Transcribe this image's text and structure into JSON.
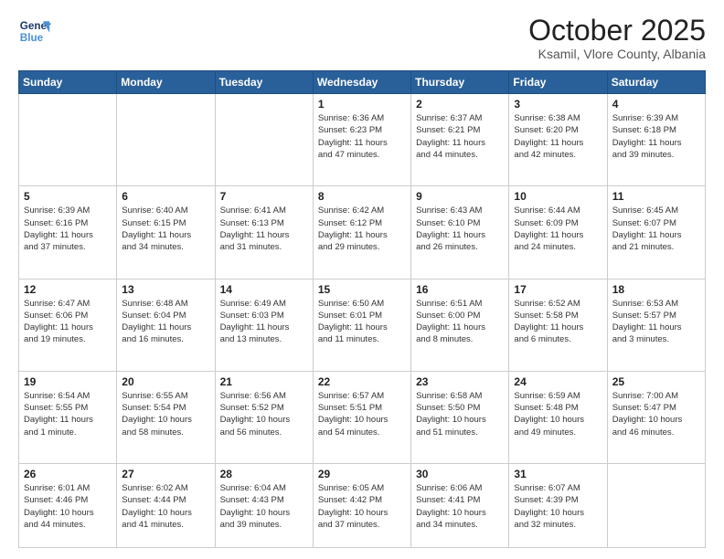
{
  "header": {
    "logo_line1": "General",
    "logo_line2": "Blue",
    "month": "October 2025",
    "location": "Ksamil, Vlore County, Albania"
  },
  "days_of_week": [
    "Sunday",
    "Monday",
    "Tuesday",
    "Wednesday",
    "Thursday",
    "Friday",
    "Saturday"
  ],
  "weeks": [
    [
      {
        "day": "",
        "info": ""
      },
      {
        "day": "",
        "info": ""
      },
      {
        "day": "",
        "info": ""
      },
      {
        "day": "1",
        "info": "Sunrise: 6:36 AM\nSunset: 6:23 PM\nDaylight: 11 hours\nand 47 minutes."
      },
      {
        "day": "2",
        "info": "Sunrise: 6:37 AM\nSunset: 6:21 PM\nDaylight: 11 hours\nand 44 minutes."
      },
      {
        "day": "3",
        "info": "Sunrise: 6:38 AM\nSunset: 6:20 PM\nDaylight: 11 hours\nand 42 minutes."
      },
      {
        "day": "4",
        "info": "Sunrise: 6:39 AM\nSunset: 6:18 PM\nDaylight: 11 hours\nand 39 minutes."
      }
    ],
    [
      {
        "day": "5",
        "info": "Sunrise: 6:39 AM\nSunset: 6:16 PM\nDaylight: 11 hours\nand 37 minutes."
      },
      {
        "day": "6",
        "info": "Sunrise: 6:40 AM\nSunset: 6:15 PM\nDaylight: 11 hours\nand 34 minutes."
      },
      {
        "day": "7",
        "info": "Sunrise: 6:41 AM\nSunset: 6:13 PM\nDaylight: 11 hours\nand 31 minutes."
      },
      {
        "day": "8",
        "info": "Sunrise: 6:42 AM\nSunset: 6:12 PM\nDaylight: 11 hours\nand 29 minutes."
      },
      {
        "day": "9",
        "info": "Sunrise: 6:43 AM\nSunset: 6:10 PM\nDaylight: 11 hours\nand 26 minutes."
      },
      {
        "day": "10",
        "info": "Sunrise: 6:44 AM\nSunset: 6:09 PM\nDaylight: 11 hours\nand 24 minutes."
      },
      {
        "day": "11",
        "info": "Sunrise: 6:45 AM\nSunset: 6:07 PM\nDaylight: 11 hours\nand 21 minutes."
      }
    ],
    [
      {
        "day": "12",
        "info": "Sunrise: 6:47 AM\nSunset: 6:06 PM\nDaylight: 11 hours\nand 19 minutes."
      },
      {
        "day": "13",
        "info": "Sunrise: 6:48 AM\nSunset: 6:04 PM\nDaylight: 11 hours\nand 16 minutes."
      },
      {
        "day": "14",
        "info": "Sunrise: 6:49 AM\nSunset: 6:03 PM\nDaylight: 11 hours\nand 13 minutes."
      },
      {
        "day": "15",
        "info": "Sunrise: 6:50 AM\nSunset: 6:01 PM\nDaylight: 11 hours\nand 11 minutes."
      },
      {
        "day": "16",
        "info": "Sunrise: 6:51 AM\nSunset: 6:00 PM\nDaylight: 11 hours\nand 8 minutes."
      },
      {
        "day": "17",
        "info": "Sunrise: 6:52 AM\nSunset: 5:58 PM\nDaylight: 11 hours\nand 6 minutes."
      },
      {
        "day": "18",
        "info": "Sunrise: 6:53 AM\nSunset: 5:57 PM\nDaylight: 11 hours\nand 3 minutes."
      }
    ],
    [
      {
        "day": "19",
        "info": "Sunrise: 6:54 AM\nSunset: 5:55 PM\nDaylight: 11 hours\nand 1 minute."
      },
      {
        "day": "20",
        "info": "Sunrise: 6:55 AM\nSunset: 5:54 PM\nDaylight: 10 hours\nand 58 minutes."
      },
      {
        "day": "21",
        "info": "Sunrise: 6:56 AM\nSunset: 5:52 PM\nDaylight: 10 hours\nand 56 minutes."
      },
      {
        "day": "22",
        "info": "Sunrise: 6:57 AM\nSunset: 5:51 PM\nDaylight: 10 hours\nand 54 minutes."
      },
      {
        "day": "23",
        "info": "Sunrise: 6:58 AM\nSunset: 5:50 PM\nDaylight: 10 hours\nand 51 minutes."
      },
      {
        "day": "24",
        "info": "Sunrise: 6:59 AM\nSunset: 5:48 PM\nDaylight: 10 hours\nand 49 minutes."
      },
      {
        "day": "25",
        "info": "Sunrise: 7:00 AM\nSunset: 5:47 PM\nDaylight: 10 hours\nand 46 minutes."
      }
    ],
    [
      {
        "day": "26",
        "info": "Sunrise: 6:01 AM\nSunset: 4:46 PM\nDaylight: 10 hours\nand 44 minutes."
      },
      {
        "day": "27",
        "info": "Sunrise: 6:02 AM\nSunset: 4:44 PM\nDaylight: 10 hours\nand 41 minutes."
      },
      {
        "day": "28",
        "info": "Sunrise: 6:04 AM\nSunset: 4:43 PM\nDaylight: 10 hours\nand 39 minutes."
      },
      {
        "day": "29",
        "info": "Sunrise: 6:05 AM\nSunset: 4:42 PM\nDaylight: 10 hours\nand 37 minutes."
      },
      {
        "day": "30",
        "info": "Sunrise: 6:06 AM\nSunset: 4:41 PM\nDaylight: 10 hours\nand 34 minutes."
      },
      {
        "day": "31",
        "info": "Sunrise: 6:07 AM\nSunset: 4:39 PM\nDaylight: 10 hours\nand 32 minutes."
      },
      {
        "day": "",
        "info": ""
      }
    ]
  ]
}
